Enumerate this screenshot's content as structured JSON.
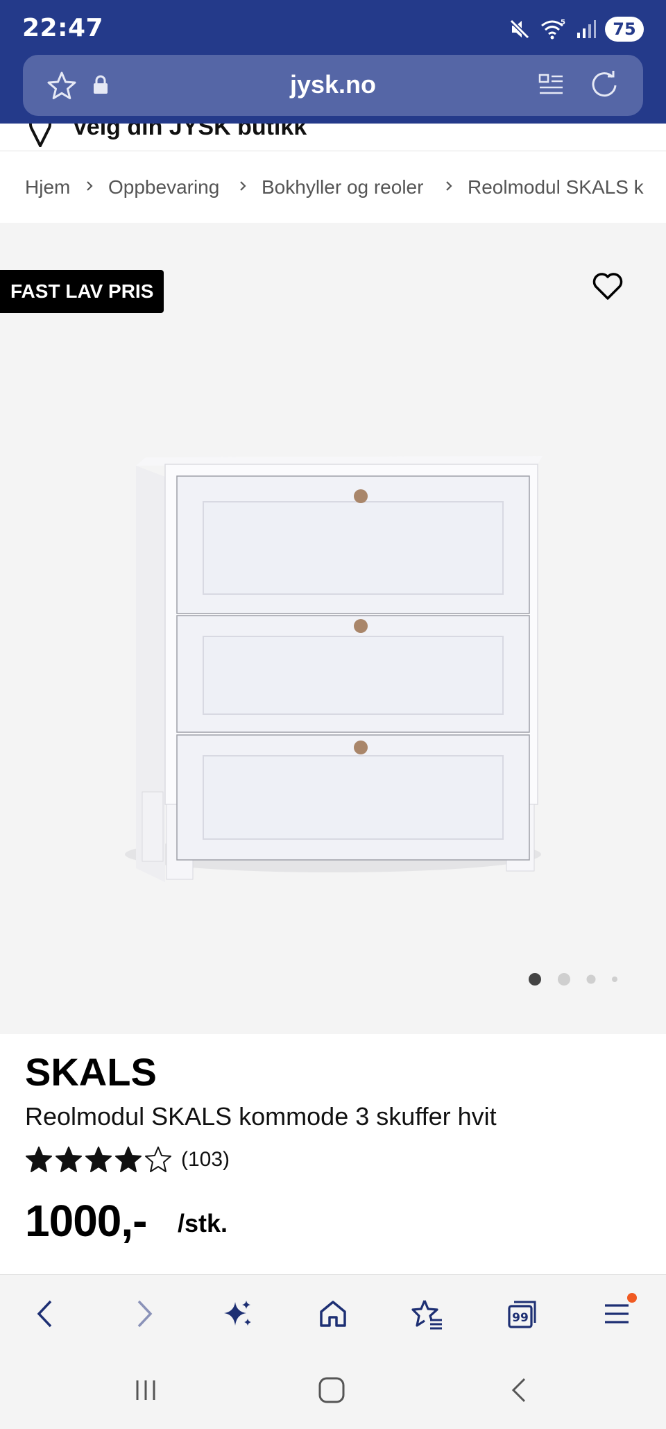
{
  "status_bar": {
    "time": "22:47",
    "battery": "75",
    "icons": [
      "mute-icon",
      "wifi-icon",
      "signal-icon"
    ]
  },
  "browser": {
    "url": "jysk.no",
    "icons": [
      "favorite-star-icon",
      "lock-icon",
      "reader-mode-icon",
      "reload-icon"
    ]
  },
  "store_selector": {
    "label": "Velg din JYSK butikk"
  },
  "breadcrumb": {
    "items": [
      "Hjem",
      "Oppbevaring",
      "Bokhyller og reoler",
      "Reolmodul SKALS k"
    ]
  },
  "gallery": {
    "badge": "FAST LAV PRIS",
    "image_count": 4,
    "active_index": 0
  },
  "product": {
    "brand": "SKALS",
    "name": "Reolmodul SKALS kommode 3 skuffer hvit",
    "rating": 4,
    "rating_max": 5,
    "review_count": "(103)",
    "price": "1000,-",
    "unit": "/stk."
  },
  "toolbar": {
    "items": [
      "back-icon",
      "forward-icon",
      "ai-sparkle-icon",
      "home-icon",
      "bookmarks-icon",
      "tabs-icon",
      "menu-icon"
    ],
    "tabs_count": "99"
  },
  "navbar": {
    "items": [
      "recent-apps-icon",
      "home-nav-icon",
      "back-nav-icon"
    ]
  },
  "colors": {
    "chrome": "#243a8a",
    "url_bar": "#5566a6",
    "toolbar_icon": "#1d2f73",
    "notification_dot": "#f05a22"
  }
}
